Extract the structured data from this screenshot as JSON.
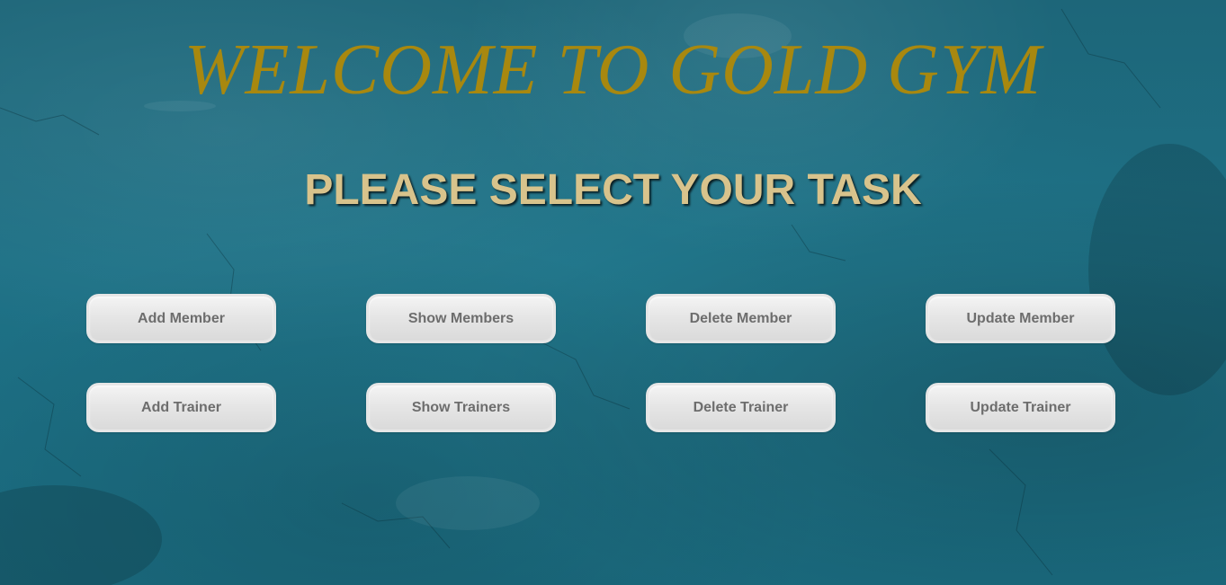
{
  "page": {
    "title": "WELCOME TO GOLD GYM",
    "subtitle": "PLEASE SELECT YOUR TASK"
  },
  "colors": {
    "background": "#1c6b80",
    "title": "#a8880f",
    "subtitle": "#d8c38c",
    "button_face": "#e6e6e6",
    "button_text": "#6d6d6d"
  },
  "buttons": {
    "members": [
      {
        "label": "Add Member"
      },
      {
        "label": "Show Members"
      },
      {
        "label": "Delete Member"
      },
      {
        "label": "Update Member"
      }
    ],
    "trainers": [
      {
        "label": "Add Trainer"
      },
      {
        "label": "Show Trainers"
      },
      {
        "label": "Delete Trainer"
      },
      {
        "label": "Update Trainer"
      }
    ]
  }
}
